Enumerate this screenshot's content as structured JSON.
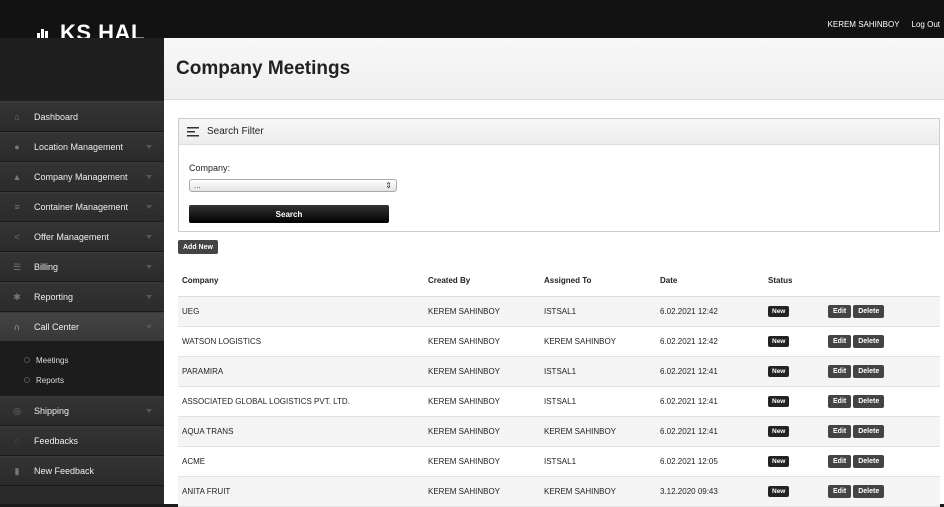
{
  "app": {
    "logo_text": "KS HAL"
  },
  "header": {
    "user_name": "KEREM SAHINBOY",
    "logout": "Log Out"
  },
  "sidebar": {
    "items": [
      {
        "label": "Dashboard",
        "icon": "home-icon"
      },
      {
        "label": "Location Management",
        "icon": "pin-icon"
      },
      {
        "label": "Company Management",
        "icon": "user-icon"
      },
      {
        "label": "Container Management",
        "icon": "database-icon"
      },
      {
        "label": "Offer Management",
        "icon": "share-icon"
      },
      {
        "label": "Billing",
        "icon": "list-icon"
      },
      {
        "label": "Reporting",
        "icon": "gears-icon"
      },
      {
        "label": "Call Center",
        "icon": "headset-icon"
      },
      {
        "label": "Shipping",
        "icon": "compass-icon"
      },
      {
        "label": "Feedbacks",
        "icon": "chat-icon"
      },
      {
        "label": "New Feedback",
        "icon": "person-icon"
      }
    ],
    "submenu": [
      "Meetings",
      "Reports"
    ]
  },
  "page": {
    "title": "Company Meetings"
  },
  "filter": {
    "title": "Search Filter",
    "company_label": "Company:",
    "company_value": "...",
    "search_label": "Search"
  },
  "add_new_label": "Add New",
  "table": {
    "headers": [
      "Company",
      "Created By",
      "Assigned To",
      "Date",
      "Status"
    ],
    "rows": [
      [
        "UEG",
        "KEREM SAHINBOY",
        "ISTSAL1",
        "6.02.2021 12:42",
        "New"
      ],
      [
        "WATSON LOGISTICS",
        "KEREM SAHINBOY",
        "KEREM SAHINBOY",
        "6.02.2021 12:42",
        "New"
      ],
      [
        "PARAMIRA",
        "KEREM SAHINBOY",
        "ISTSAL1",
        "6.02.2021 12:41",
        "New"
      ],
      [
        "ASSOCIATED GLOBAL LOGISTICS PVT. LTD.",
        "KEREM SAHINBOY",
        "ISTSAL1",
        "6.02.2021 12:41",
        "New"
      ],
      [
        "AQUA TRANS",
        "KEREM SAHINBOY",
        "KEREM SAHINBOY",
        "6.02.2021 12:41",
        "New"
      ],
      [
        "ACME",
        "KEREM SAHINBOY",
        "ISTSAL1",
        "6.02.2021 12:05",
        "New"
      ],
      [
        "ANITA FRUIT",
        "KEREM SAHINBOY",
        "KEREM SAHINBOY",
        "3.12.2020 09:43",
        "New"
      ]
    ],
    "edit_label": "Edit",
    "delete_label": "Delete"
  }
}
